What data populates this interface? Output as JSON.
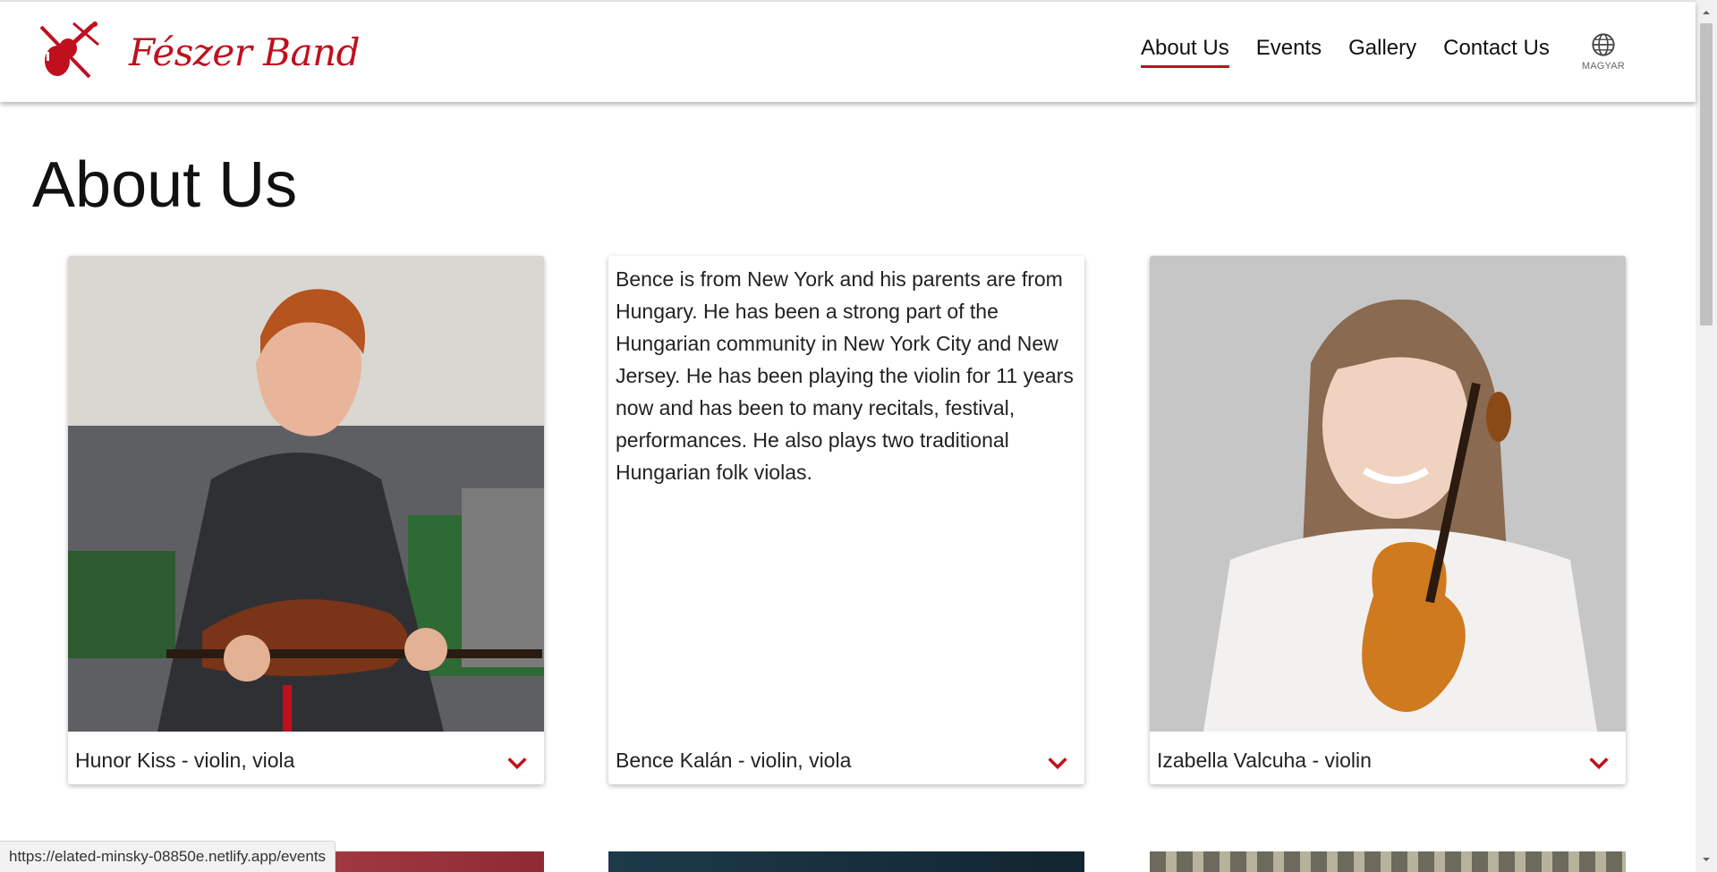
{
  "brand": {
    "name": "Fészer Band",
    "color": "#c0101e",
    "logo_icon": "violin-bow-logo"
  },
  "nav": {
    "links": [
      {
        "label": "About Us",
        "active": true
      },
      {
        "label": "Events",
        "active": false
      },
      {
        "label": "Gallery",
        "active": false
      },
      {
        "label": "Contact Us",
        "active": false
      }
    ],
    "language": {
      "icon": "globe-icon",
      "label": "MAGYAR"
    }
  },
  "page": {
    "title": "About Us"
  },
  "members": [
    {
      "caption": "Hunor Kiss - violin, viola",
      "view": "photo"
    },
    {
      "caption": "Bence Kalán - violin, viola",
      "view": "bio",
      "bio": "Bence is from New York and his parents are from Hungary. He has been a strong part of the Hungarian community in New York City and New Jersey. He has been playing the violin for 11 years now and has been to many recitals, festival, performances. He also plays two traditional Hungarian folk violas."
    },
    {
      "caption": "Izabella Valcuha - violin",
      "view": "photo"
    }
  ],
  "status_url": "https://elated-minsky-08850e.netlify.app/events",
  "colors": {
    "accent": "#c0101e",
    "text": "#111111"
  }
}
